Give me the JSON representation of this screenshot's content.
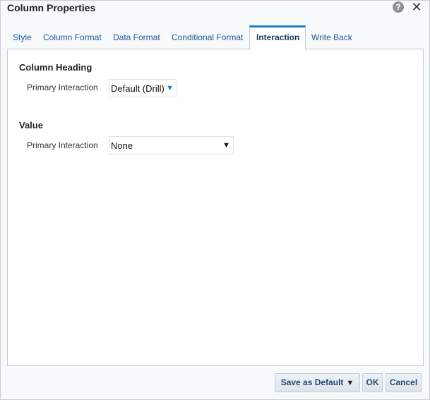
{
  "dialog": {
    "title": "Column Properties",
    "help_icon": "help-icon",
    "help_glyph": "?",
    "close_icon": "close-icon",
    "close_glyph": "✕"
  },
  "tabs": [
    {
      "label": "Style",
      "active": false
    },
    {
      "label": "Column Format",
      "active": false
    },
    {
      "label": "Data Format",
      "active": false
    },
    {
      "label": "Conditional Format",
      "active": false
    },
    {
      "label": "Interaction",
      "active": true
    },
    {
      "label": "Write Back",
      "active": false
    }
  ],
  "interaction": {
    "column_heading": {
      "title": "Column Heading",
      "field_label": "Primary Interaction",
      "selected": "Default (Drill)",
      "arrow_glyph": "▼",
      "arrow_color": "#1b7ec2"
    },
    "value": {
      "title": "Value",
      "field_label": "Primary Interaction",
      "selected": "None",
      "arrow_glyph": "▼",
      "arrow_color": "#111111"
    }
  },
  "footer": {
    "save_default_label": "Save as Default",
    "save_default_caret": "▼",
    "ok_label": "OK",
    "cancel_label": "Cancel"
  },
  "colors": {
    "accent": "#1b7ec2",
    "link": "#1a5a96",
    "border": "#c4ccd4"
  }
}
